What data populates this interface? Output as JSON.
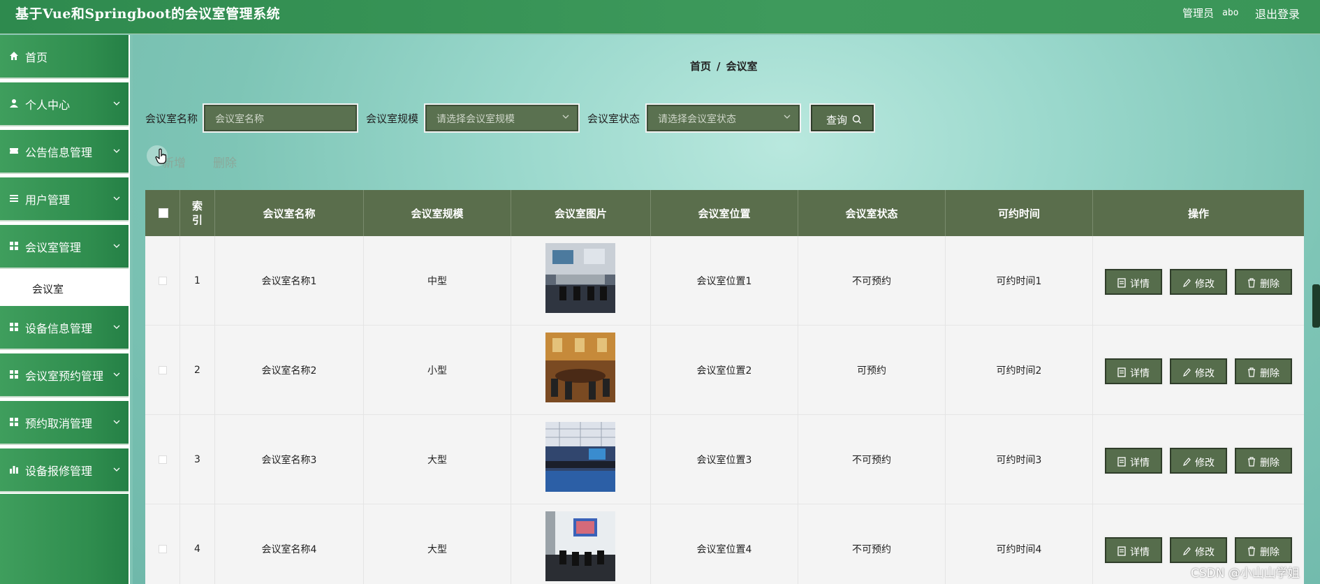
{
  "header": {
    "app_title": "基于Vue和Springboot的会议室管理系统",
    "user_role": "管理员",
    "user_name": "abo",
    "logout_label": "退出登录"
  },
  "sidebar": {
    "items": [
      {
        "label": "首页",
        "icon": "home-icon"
      },
      {
        "label": "个人中心",
        "icon": "user-icon"
      },
      {
        "label": "公告信息管理",
        "icon": "ticket-icon"
      },
      {
        "label": "用户管理",
        "icon": "list-icon"
      },
      {
        "label": "会议室管理",
        "icon": "grid-icon"
      },
      {
        "label": "设备信息管理",
        "icon": "grid-icon"
      },
      {
        "label": "会议室预约管理",
        "icon": "grid-icon"
      },
      {
        "label": "预约取消管理",
        "icon": "grid-icon"
      },
      {
        "label": "设备报修管理",
        "icon": "chart-icon"
      }
    ],
    "active_sub_item": "会议室"
  },
  "breadcrumb": {
    "home": "首页",
    "sep": "/",
    "current": "会议室"
  },
  "filters": {
    "name_label": "会议室名称",
    "name_placeholder": "会议室名称",
    "scale_label": "会议室规模",
    "scale_placeholder": "请选择会议室规模",
    "status_label": "会议室状态",
    "status_placeholder": "请选择会议室状态",
    "query_label": "查询"
  },
  "actions": {
    "add_label": "新增",
    "delete_label": "删除"
  },
  "table": {
    "columns": [
      "索引",
      "会议室名称",
      "会议室规模",
      "会议室图片",
      "会议室位置",
      "会议室状态",
      "可约时间",
      "操作"
    ],
    "row_actions": {
      "detail": "详情",
      "edit": "修改",
      "delete": "删除"
    },
    "rows": [
      {
        "index": "1",
        "name": "会议室名称1",
        "scale": "中型",
        "location": "会议室位置1",
        "status": "不可预约",
        "time": "可约时间1"
      },
      {
        "index": "2",
        "name": "会议室名称2",
        "scale": "小型",
        "location": "会议室位置2",
        "status": "可预约",
        "time": "可约时间2"
      },
      {
        "index": "3",
        "name": "会议室名称3",
        "scale": "大型",
        "location": "会议室位置3",
        "status": "不可预约",
        "time": "可约时间3"
      },
      {
        "index": "4",
        "name": "会议室名称4",
        "scale": "大型",
        "location": "会议室位置4",
        "status": "不可预约",
        "time": "可约时间4"
      }
    ]
  },
  "watermark": "CSDN @小山山学姐",
  "colors": {
    "topbar_green": "#2e8a4e",
    "sidebar_green": "#3f9e5d",
    "button_olive": "#566d4c",
    "table_header": "#5a6e4c"
  }
}
